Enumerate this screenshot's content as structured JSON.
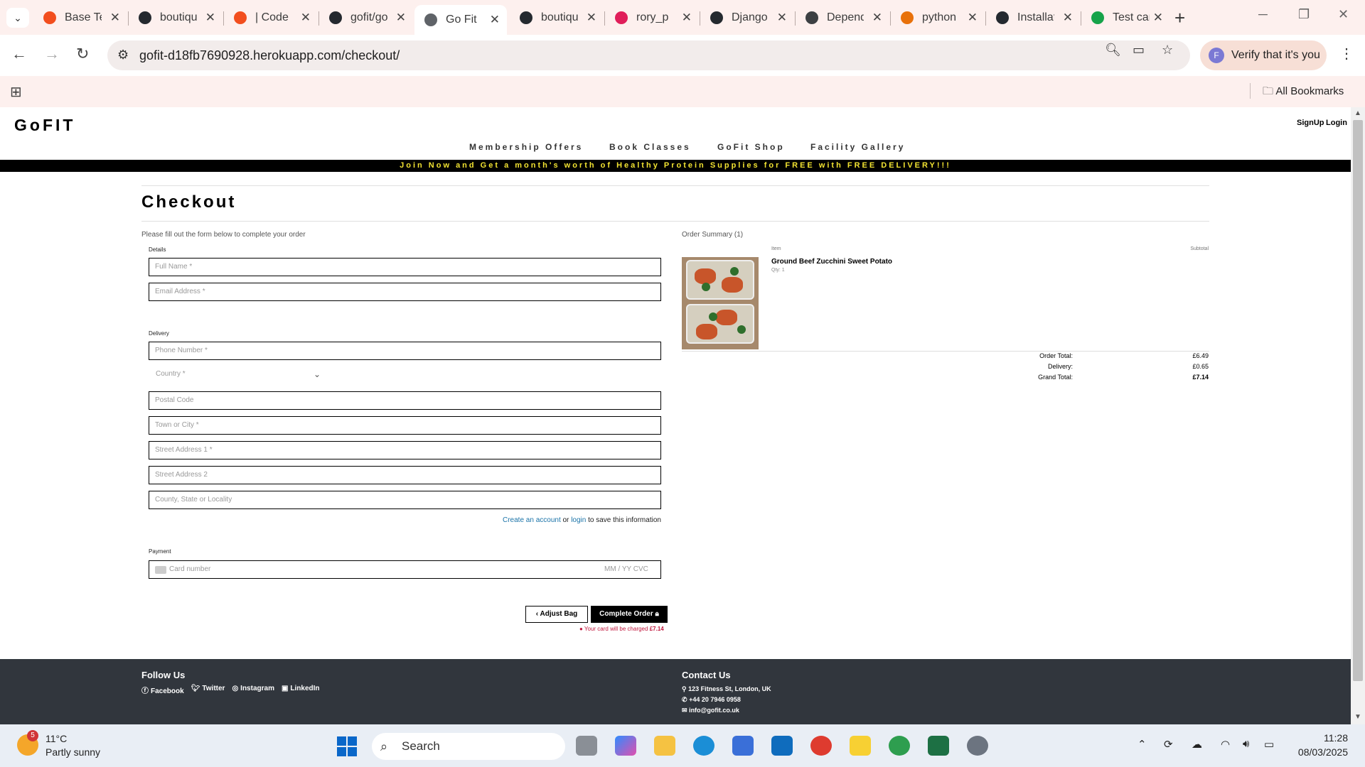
{
  "browser": {
    "tabs": [
      {
        "label": "Base Template",
        "favicon": "#f24e1e",
        "active": false
      },
      {
        "label": "boutique-ado",
        "favicon": "#24292f",
        "active": false
      },
      {
        "label": "| Code Institute",
        "favicon": "#f24e1e",
        "active": false
      },
      {
        "label": "gofit/gofit",
        "favicon": "#24292f",
        "active": false
      },
      {
        "label": "Go Fit",
        "favicon": "#5f6368",
        "active": true
      },
      {
        "label": "boutique-ado",
        "favicon": "#24292f",
        "active": false
      },
      {
        "label": "rory_p",
        "favicon": "#e01e5a",
        "active": false
      },
      {
        "label": "Django",
        "favicon": "#24292f",
        "active": false
      },
      {
        "label": "Dependencies",
        "favicon": "#3c4043",
        "active": false
      },
      {
        "label": "python",
        "favicon": "#e8710a",
        "active": false
      },
      {
        "label": "Installation",
        "favicon": "#24292f",
        "active": false
      },
      {
        "label": "Test cards",
        "favicon": "#16a34a",
        "active": false
      }
    ],
    "url": "gofit-d18fb7690928.herokuapp.com/checkout/",
    "profile_label": "Verify that it's you",
    "profile_initial": "F",
    "bookmarks_label": "All Bookmarks"
  },
  "site": {
    "brand": "GoFIT",
    "auth": {
      "signup": "SignUp",
      "login": "Login"
    },
    "nav": [
      "Membership Offers",
      "Book Classes",
      "GoFit Shop",
      "Facility Gallery"
    ],
    "banner": "Join Now and Get a month's worth of Healthy Protein Supplies for FREE with FREE DELIVERY!!!"
  },
  "checkout": {
    "title": "Checkout",
    "lead": "Please fill out the form below to complete your order",
    "details_legend": "Details",
    "full_name_placeholder": "Full Name *",
    "email_placeholder": "Email Address *",
    "delivery_legend": "Delivery",
    "phone_placeholder": "Phone Number *",
    "country_placeholder": "Country *",
    "postal_placeholder": "Postal Code",
    "town_placeholder": "Town or City *",
    "street1_placeholder": "Street Address 1 *",
    "street2_placeholder": "Street Address 2",
    "county_placeholder": "County, State or Locality",
    "create_account": "Create an account",
    "or_text": "or",
    "login_link": "login",
    "save_text": "to save this information",
    "payment_legend": "Payment",
    "card_placeholder": "Card number",
    "card_meta": "MM / YY  CVC",
    "adjust_bag": "Adjust Bag",
    "complete_order": "Complete Order",
    "charge_text": "Your card will be charged",
    "charge_amount": "£7.14"
  },
  "summary": {
    "heading": "Order Summary (1)",
    "col_item": "Item",
    "col_subtotal": "Subtotal",
    "product_name": "Ground Beef Zucchini Sweet Potato",
    "product_qty": "Qty: 1",
    "order_total_label": "Order Total:",
    "order_total": "£6.49",
    "delivery_label": "Delivery:",
    "delivery": "£0.65",
    "grand_total_label": "Grand Total:",
    "grand_total": "£7.14"
  },
  "footer": {
    "follow_heading": "Follow Us",
    "social": [
      "Facebook",
      "Twitter",
      "Instagram",
      "LinkedIn"
    ],
    "contact_heading": "Contact Us",
    "address": "123 Fitness St, London, UK",
    "phone": "+44 20 7946 0958",
    "email": "info@gofit.co.uk"
  },
  "taskbar": {
    "weather_badge": "5",
    "temperature": "11°C",
    "weather_desc": "Partly sunny",
    "search_label": "Search",
    "time": "11:28",
    "date": "08/03/2025"
  }
}
